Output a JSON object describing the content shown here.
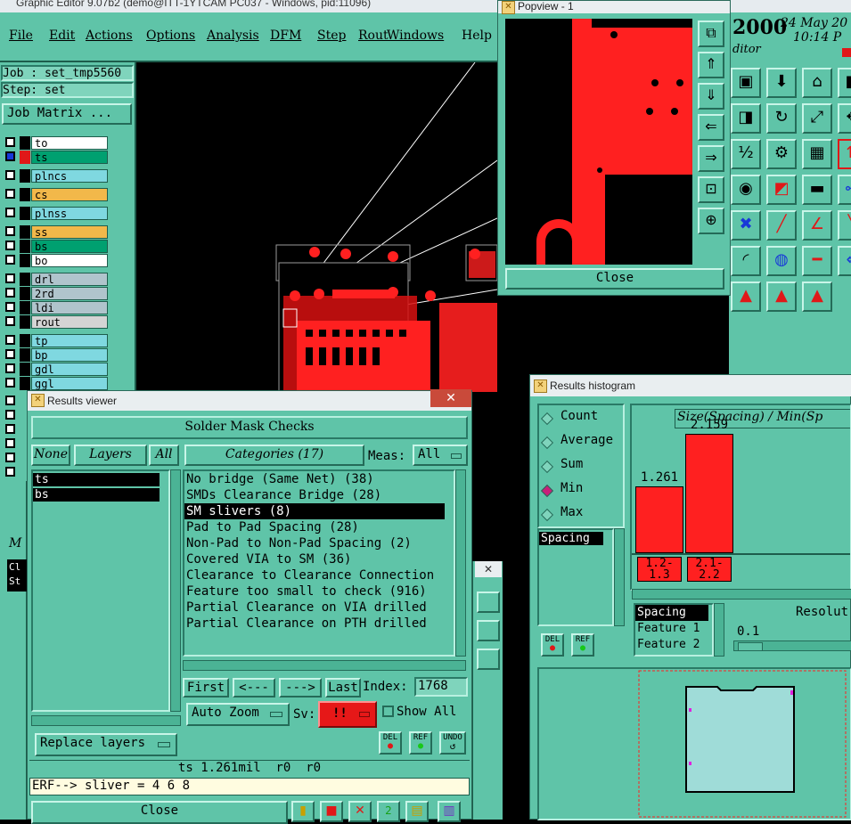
{
  "main_window": {
    "title": "Graphic Editor 9.07b2 (demo@ITT-1YTCAM PC037 - Windows, pid:11096)",
    "menu": [
      "File",
      "Edit",
      "Actions",
      "Options",
      "Analysis",
      "DFM",
      "Step",
      "Rout",
      "Windows"
    ],
    "help": "Help",
    "year": "2000",
    "date": "24 May 20",
    "time": "10:14 P",
    "editor_label": "ditor"
  },
  "left_panel": {
    "job": "Job : set_tmp5560",
    "step": "Step: set",
    "job_matrix_button": "Job Matrix ...",
    "layers": [
      {
        "name": "to",
        "color": "#ffffff"
      },
      {
        "name": "ts",
        "color": "#00a070"
      },
      {
        "name": "plncs",
        "color": "#7fd8e0"
      },
      {
        "name": "cs",
        "color": "#f2b84a"
      },
      {
        "name": "plnss",
        "color": "#7fd8e0"
      },
      {
        "name": "ss",
        "color": "#f2b84a"
      },
      {
        "name": "bs",
        "color": "#00a070"
      },
      {
        "name": "bo",
        "color": "#ffffff"
      },
      {
        "name": "drl",
        "color": "#b0c4cc"
      },
      {
        "name": "2rd",
        "color": "#b0c4cc"
      },
      {
        "name": "ldi",
        "color": "#b0c4cc"
      },
      {
        "name": "rout",
        "color": "#d4d4d4"
      },
      {
        "name": "tp",
        "color": "#7fd8e0"
      },
      {
        "name": "bp",
        "color": "#7fd8e0"
      },
      {
        "name": "gdl",
        "color": "#7fd8e0"
      },
      {
        "name": "ggl",
        "color": "#7fd8e0"
      }
    ]
  },
  "popview": {
    "title": "Popview - 1",
    "close": "Close"
  },
  "results_viewer": {
    "title": "Results viewer",
    "heading": "Solder Mask Checks",
    "none_btn": "None",
    "layers_label": "Layers",
    "all_btn": "All",
    "layer_list": [
      "ts",
      "bs"
    ],
    "categories_label": "Categories (17)",
    "meas_label": "Meas:",
    "meas_value": "All",
    "categories": [
      "No bridge (Same Net) (38)",
      "SMDs Clearance Bridge (28)",
      "SM slivers (8)",
      "Pad to Pad Spacing (28)",
      "Non-Pad to Non-Pad Spacing (2)",
      "Covered VIA to SM (36)",
      "Clearance to Clearance Connection",
      "Feature too small to check (916)",
      "Partial Clearance on VIA drilled",
      "Partial Clearance on PTH drilled"
    ],
    "selected_index": 2,
    "first": "First",
    "prev": "<---",
    "next": "--->",
    "last": "Last",
    "index_label": "Index:",
    "index_value": "1768",
    "auto_zoom": "Auto Zoom",
    "sv_label": "Sv:",
    "sv_value": "!!",
    "show_all": "Show All",
    "del": "DEL",
    "ref": "REF",
    "undo": "UNDO",
    "replace_layers": "Replace layers",
    "status": "ts 1.261mil  r0  r0",
    "erf": "ERF--> sliver = 4 6 8",
    "close": "Close"
  },
  "histogram": {
    "title": "Results histogram",
    "options": [
      "Count",
      "Average",
      "Sum",
      "Min",
      "Max"
    ],
    "selected_option": "Min",
    "list_item": "Spacing",
    "del": "DEL",
    "ref": "REF",
    "lower_list": [
      "Spacing",
      "Feature 1",
      "Feature 2"
    ],
    "resolution_label": "Resolut",
    "resolution_value": "0.1",
    "chart_title": "Size(Spacing) / Min(Sp",
    "bars": [
      {
        "value": "1.261",
        "range_top": "1.2-",
        "range_bottom": "1.3",
        "height_frac": 0.56
      },
      {
        "value": "2.159",
        "range_top": "2.1-",
        "range_bottom": "2.2",
        "height_frac": 1.0
      }
    ],
    "colors": {
      "bar": "#ff2020"
    }
  },
  "side_misc": {
    "frag1": "M",
    "frag2": "Cl",
    "frag3": "St"
  }
}
